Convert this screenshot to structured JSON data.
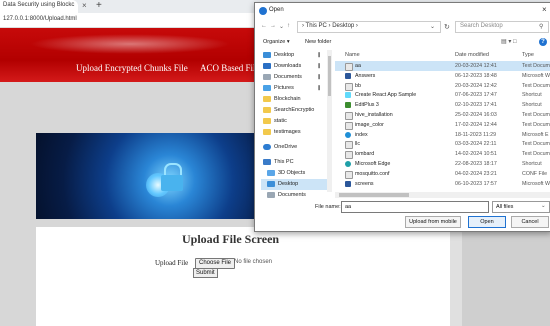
{
  "browser": {
    "tab_title": "Data Security using Blockc",
    "tab_close": "×",
    "new_tab": "+",
    "address": "127.0.0.1:8000/Upload.html"
  },
  "page": {
    "nav_items": [
      "Upload Encrypted Chunks File",
      "ACO Based Fil"
    ],
    "upload_title": "Upload File Screen",
    "upload_label": "Upload File",
    "choose_button": "Choose File",
    "no_file_text": "No file chosen",
    "submit_button": "Submit",
    "colors": {
      "header_red": "#b20000",
      "body_gray": "#d7d7d7"
    }
  },
  "dialog": {
    "title": "Open",
    "close": "×",
    "path": "› This PC › Desktop ›",
    "search_placeholder": "Search Desktop",
    "toolbar": {
      "organize": "Organize ▾",
      "new_folder": "New folder"
    },
    "nav_pane": [
      {
        "label": "Desktop",
        "icon": "folder-icon-blue",
        "pinned": true
      },
      {
        "label": "Downloads",
        "icon": "download-icon",
        "pinned": true
      },
      {
        "label": "Documents",
        "icon": "documents-icon",
        "pinned": true
      },
      {
        "label": "Pictures",
        "icon": "pictures-icon",
        "pinned": true
      },
      {
        "label": "Blockchain",
        "icon": "folder-icon",
        "pinned": false
      },
      {
        "label": "SearchEncryptio",
        "icon": "folder-icon",
        "pinned": false
      },
      {
        "label": "static",
        "icon": "folder-icon",
        "pinned": false
      },
      {
        "label": "testimages",
        "icon": "folder-icon",
        "pinned": false
      },
      {
        "label": "OneDrive",
        "icon": "cloud-icon",
        "pinned": false
      },
      {
        "label": "This PC",
        "icon": "pc-icon",
        "pinned": false
      },
      {
        "label": "3D Objects",
        "icon": "cube-icon",
        "pinned": false
      },
      {
        "label": "Desktop",
        "icon": "folder-icon-blue",
        "pinned": false,
        "selected": true
      },
      {
        "label": "Documents",
        "icon": "documents-icon",
        "pinned": false
      }
    ],
    "columns": [
      "Name",
      "Date modified",
      "Type"
    ],
    "files": [
      {
        "name": "aa",
        "date": "20-03-2024 12:41",
        "type": "Text Docum",
        "selected": true
      },
      {
        "name": "Answers",
        "date": "06-12-2023 18:48",
        "type": "Microsoft W"
      },
      {
        "name": "bb",
        "date": "20-03-2024 12:42",
        "type": "Text Docum"
      },
      {
        "name": "Create React App Sample",
        "date": "07-06-2023 17:47",
        "type": "Shortcut"
      },
      {
        "name": "EditPlus 3",
        "date": "02-10-2023 17:41",
        "type": "Shortcut"
      },
      {
        "name": "hive_installation",
        "date": "25-02-2024 16:03",
        "type": "Text Docum"
      },
      {
        "name": "image_color",
        "date": "17-02-2024 12:44",
        "type": "Text Docum"
      },
      {
        "name": "index",
        "date": "18-11-2023 11:29",
        "type": "Microsoft E"
      },
      {
        "name": "llc",
        "date": "03-03-2024 22:11",
        "type": "Text Docum"
      },
      {
        "name": "lombard",
        "date": "14-02-2024 10:51",
        "type": "Text Docum"
      },
      {
        "name": "Microsoft Edge",
        "date": "22-08-2023 18:17",
        "type": "Shortcut"
      },
      {
        "name": "mosquitto.conf",
        "date": "04-02-2024 23:21",
        "type": "CONF File"
      },
      {
        "name": "screens",
        "date": "06-10-2023 17:57",
        "type": "Microsoft W"
      }
    ],
    "file_name_label": "File name:",
    "file_name_value": "aa",
    "filter_value": "All files",
    "btn_upload_mobile": "Upload from mobile",
    "btn_open": "Open",
    "btn_cancel": "Cancel"
  }
}
